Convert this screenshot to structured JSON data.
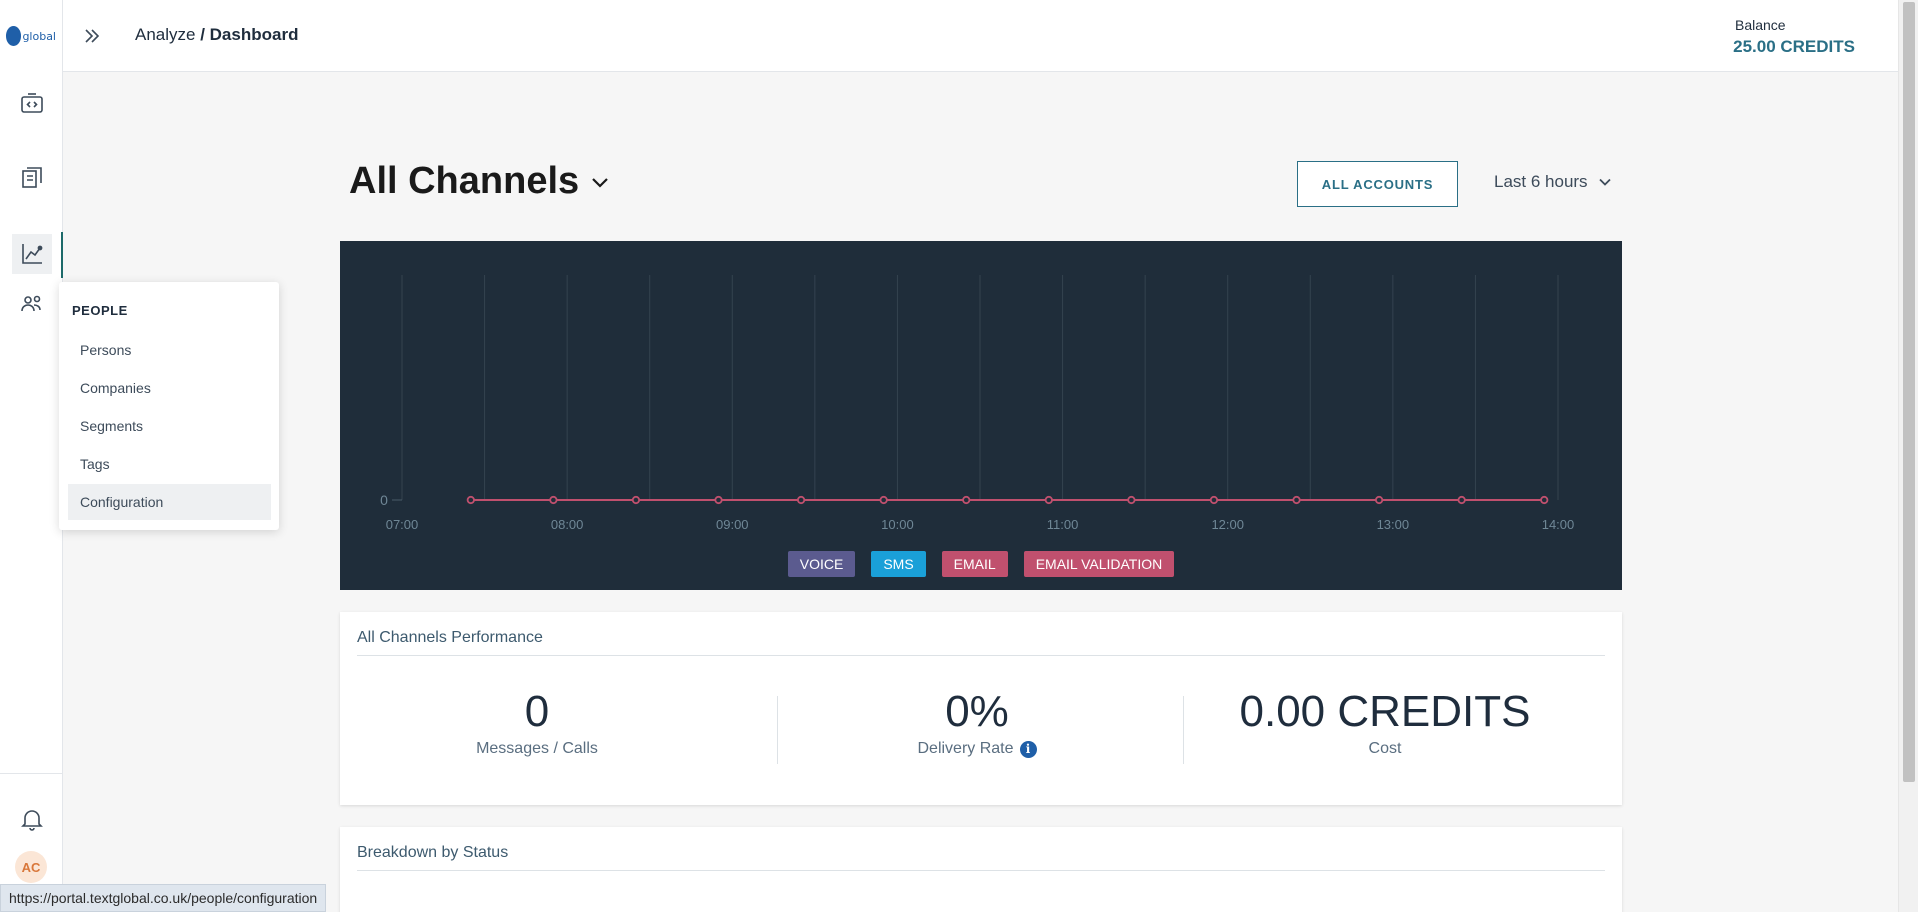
{
  "logo": {
    "text": "global"
  },
  "header": {
    "breadcrumb_parent": "Analyze",
    "breadcrumb_sep": " / ",
    "breadcrumb_current": "Dashboard",
    "balance_label": "Balance",
    "balance_value": "25.00 CREDITS"
  },
  "sidebar": {
    "items": [
      {
        "name": "developer-icon"
      },
      {
        "name": "documents-icon"
      },
      {
        "name": "analytics-icon",
        "active": true
      },
      {
        "name": "people-icon"
      }
    ],
    "avatar_initials": "AC"
  },
  "people_menu": {
    "heading": "PEOPLE",
    "items": [
      "Persons",
      "Companies",
      "Segments",
      "Tags",
      "Configuration"
    ],
    "hovered": "Configuration"
  },
  "dashboard": {
    "title": "All Channels",
    "accounts_button": "ALL ACCOUNTS",
    "time_range": "Last 6 hours"
  },
  "chart_data": {
    "type": "line",
    "x_ticks": [
      "07:00",
      "08:00",
      "09:00",
      "10:00",
      "11:00",
      "12:00",
      "13:00",
      "14:00"
    ],
    "y_ticks": [
      "0"
    ],
    "series": [
      {
        "name": "VOICE",
        "color": "#5b5b8f",
        "values": []
      },
      {
        "name": "SMS",
        "color": "#1aa0d8",
        "values": []
      },
      {
        "name": "EMAIL",
        "color": "#c0506e",
        "values": []
      },
      {
        "name": "EMAIL VALIDATION",
        "color": "#c0506e",
        "values": [
          0,
          0,
          0,
          0,
          0,
          0,
          0,
          0,
          0,
          0,
          0,
          0,
          0,
          0
        ]
      }
    ],
    "point_times": [
      "07:25",
      "07:55",
      "08:25",
      "08:55",
      "09:25",
      "09:55",
      "10:25",
      "10:55",
      "11:25",
      "11:55",
      "12:25",
      "12:55",
      "13:25",
      "13:55"
    ],
    "xlim": [
      "07:00",
      "14:00"
    ],
    "grid": true,
    "legend_position": "bottom"
  },
  "performance": {
    "title": "All Channels Performance",
    "metrics": [
      {
        "value": "0",
        "label": "Messages / Calls"
      },
      {
        "value": "0%",
        "label": "Delivery Rate"
      },
      {
        "value": "0.00 CREDITS",
        "label": "Cost"
      }
    ]
  },
  "breakdown": {
    "title": "Breakdown by Status"
  },
  "status_bar": {
    "url": "https://portal.textglobal.co.uk/people/configuration"
  },
  "colors": {
    "accent": "#2a6f86",
    "chart_bg": "#1f2d3a",
    "line": "#c0506e"
  }
}
